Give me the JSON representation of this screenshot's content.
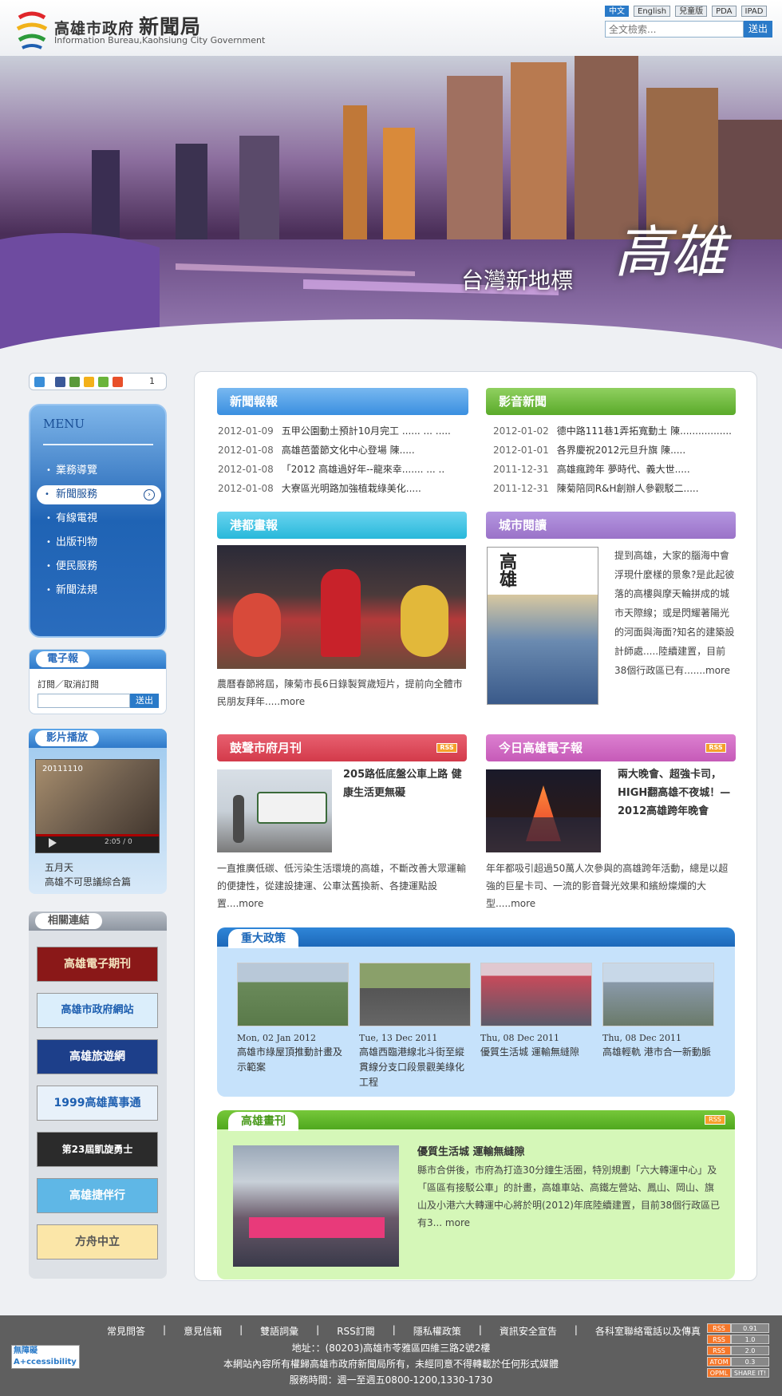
{
  "header": {
    "brand_main": "高雄市政府",
    "brand_main_big": "新聞局",
    "brand_sub": "Information Bureau,Kaohsiung City Government",
    "languages": [
      "中文",
      "English",
      "兒童版",
      "PDA",
      "IPAD"
    ],
    "search_placeholder": "全文檢索...",
    "search_button": "送出"
  },
  "banner": {
    "slogan": "台灣新地標",
    "city": "高雄"
  },
  "share": {
    "count": "1",
    "icons": [
      "google-plus-icon",
      "facebook-icon",
      "plurk-icon",
      "bookmark-star-icon",
      "google-icon",
      "add-icon"
    ]
  },
  "menu": {
    "title": "MENU",
    "items": [
      "業務導覽",
      "新聞服務",
      "有線電視",
      "出版刊物",
      "便民服務",
      "新聞法規"
    ],
    "active_index": 1
  },
  "epaper": {
    "title": "電子報",
    "label": "訂閱／取消訂閱",
    "button": "送出"
  },
  "video": {
    "title": "影片播放",
    "date_overlay": "20111110",
    "time": "2:05 / 0",
    "caption_line1": "五月天",
    "caption_line2": "高雄不可思議綜合篇"
  },
  "links": {
    "title": "相關連結",
    "banners": [
      "高雄電子期刊",
      "高雄市政府網站",
      "高雄旅遊網",
      "1999高雄萬事通",
      "第23屆凱旋勇士",
      "高雄捷伴行",
      "方舟中立"
    ]
  },
  "news": {
    "title": "新聞報報",
    "items": [
      {
        "date": "2012-01-09",
        "text": "五甲公園動土預計10月完工 ...... ... ....."
      },
      {
        "date": "2012-01-08",
        "text": "高雄芭蕾節文化中心登場 陳....."
      },
      {
        "date": "2012-01-08",
        "text": "「2012 高雄過好年--龍來幸....... ... .."
      },
      {
        "date": "2012-01-08",
        "text": "大寮區光明路加強植栽綠美化....."
      }
    ]
  },
  "video_news": {
    "title": "影音新聞",
    "items": [
      {
        "date": "2012-01-02",
        "text": "德中路111巷1弄拓寬動土 陳................."
      },
      {
        "date": "2012-01-01",
        "text": "各界慶祝2012元旦升旗 陳....."
      },
      {
        "date": "2011-12-31",
        "text": "高雄瘋跨年 夢時代、義大世....."
      },
      {
        "date": "2011-12-31",
        "text": "陳菊陪同R&H創辦人參觀駁二....."
      }
    ]
  },
  "harbor": {
    "title": "港都畫報",
    "text": "農曆春節將屆，陳菊市長6日錄製賀歲短片，提前向全體市民朋友拜年.....",
    "more": "more"
  },
  "city_read": {
    "title": "城市閱讀",
    "cover_title": "高雄",
    "text": "提到高雄，大家的腦海中會浮現什麼樣的景象?是此起彼落的高樓與摩天輪拼成的城市天際線；或是閃耀著陽光的河面與海面?知名的建築設計師處.....陸續建置，目前38個行政區已有.......",
    "more": "more"
  },
  "monthly": {
    "title": "鼓聲市府月刊",
    "rss": "RSS",
    "headline": "205路低底盤公車上路 健康生活更無礙",
    "text": "一直推廣低碳、低污染生活環境的高雄，不斷改善大眾運輸的便捷性，從建設捷運、公車汰舊換新、各捷運點設置....",
    "more": "more"
  },
  "enews": {
    "title": "今日高雄電子報",
    "rss": "RSS",
    "headline": "兩大晚會、超強卡司，HIGH翻高雄不夜城！—2012高雄跨年晚會",
    "text": "年年都吸引超過50萬人次參與的高雄跨年活動，總是以超強的巨星卡司、一流的影音聲光效果和繽紛燦爛的大型.....",
    "more": "more"
  },
  "policy": {
    "title": "重大政策",
    "items": [
      {
        "date": "Mon, 02 Jan 2012",
        "text": "高雄市綠屋頂推動計畫及示範案"
      },
      {
        "date": "Tue, 13 Dec 2011",
        "text": "高雄西臨港線北斗街至縱貫線分支口段景觀美綠化工程"
      },
      {
        "date": "Thu, 08 Dec 2011",
        "text": "優質生活城 運輸無縫隙"
      },
      {
        "date": "Thu, 08 Dec 2011",
        "text": "高雄輕軌 港市合一新動脈"
      }
    ]
  },
  "magazine": {
    "title": "高雄畫刊",
    "rss": "RSS",
    "headline": "優質生活城 運輸無縫隙",
    "text": "縣市合併後，市府為打造30分鐘生活圈，特別規劃「六大轉運中心」及「區區有接駁公車」的計畫，高雄車站、高鐵左營站、鳳山、岡山、旗山及小港六大轉運中心將於明(2012)年底陸續建置，目前38個行政區已有3...",
    "more": "more"
  },
  "footer": {
    "links": [
      "常見問答",
      "意見信箱",
      "雙語詞彙",
      "RSS訂閱",
      "隱私權政策",
      "資訊安全宣告",
      "各科室聯絡電話以及傳真"
    ],
    "address": "地址：：(80203)高雄市苓雅區四維三路2號2樓",
    "copyright": "本網站內容所有權歸高雄市政府新聞局所有，未經同意不得轉載於任何形式媒體",
    "hours": "服務時間：週一至週五0800-1200,1330-1730",
    "access_line1": "無障礙",
    "access_line2": "A+ccessibility",
    "feeds": [
      {
        "k": "RSS",
        "v": "0.91"
      },
      {
        "k": "RSS",
        "v": "1.0"
      },
      {
        "k": "RSS",
        "v": "2.0"
      },
      {
        "k": "ATOM",
        "v": "0.3"
      },
      {
        "k": "OPML",
        "v": "SHARE IT!"
      }
    ]
  },
  "colors": {
    "blue_head": "#3a8fe0",
    "green_head": "#68b83a",
    "cyan_head": "#27b8da",
    "purple_head": "#9a72c8",
    "red_head": "#d33a4a",
    "pink_head": "#c65ab8"
  }
}
